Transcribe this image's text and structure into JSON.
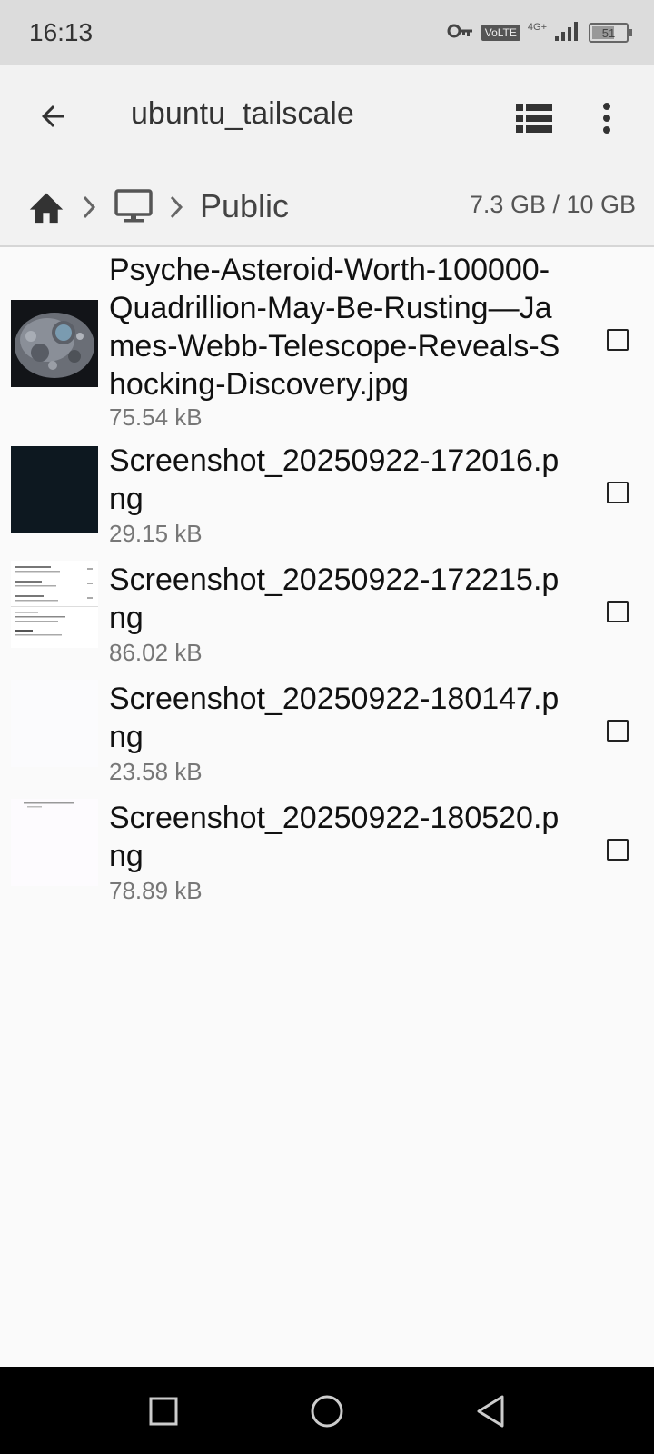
{
  "status": {
    "time": "16:13",
    "volte": "VoLTE",
    "network": "4G+",
    "battery": "51"
  },
  "appbar": {
    "title": "ubuntu_tailscale"
  },
  "path": {
    "current": "Public",
    "storage": "7.3 GB / 10 GB"
  },
  "files": [
    {
      "name": "Psyche-Asteroid-Worth-100000-Quadrillion-May-Be-Rusting—James-Webb-Telescope-Reveals-Shocking-Discovery.jpg",
      "size": "75.54 kB"
    },
    {
      "name": "Screenshot_20250922-172016.png",
      "size": "29.15 kB"
    },
    {
      "name": "Screenshot_20250922-172215.png",
      "size": "86.02 kB"
    },
    {
      "name": "Screenshot_20250922-180147.png",
      "size": "23.58 kB"
    },
    {
      "name": "Screenshot_20250922-180520.png",
      "size": "78.89 kB"
    }
  ],
  "icons": {
    "back": "arrow-left-icon",
    "list_view": "list-view-icon",
    "more": "more-vert-icon",
    "home": "home-icon",
    "computer": "computer-icon",
    "nav_recent": "square-icon",
    "nav_home": "circle-icon",
    "nav_back": "triangle-icon"
  },
  "colors": {
    "appbar_bg": "#f2f2f2",
    "status_bg": "#dcdcdc",
    "navbar_bg": "#000000"
  }
}
